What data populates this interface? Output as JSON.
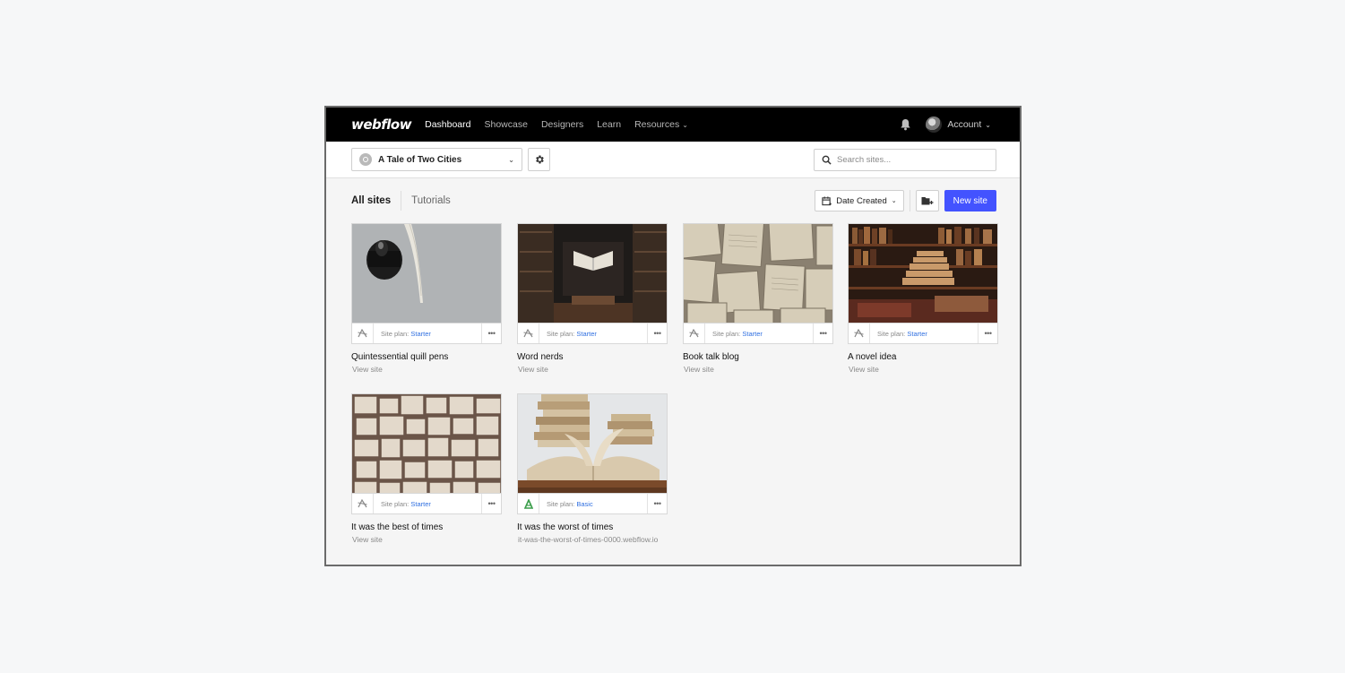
{
  "nav": {
    "logo": "webflow",
    "links": [
      "Dashboard",
      "Showcase",
      "Designers",
      "Learn",
      "Resources"
    ],
    "account": "Account"
  },
  "subbar": {
    "site_name": "A Tale of Two Cities",
    "search_placeholder": "Search sites..."
  },
  "toolbar": {
    "tabs": [
      "All sites",
      "Tutorials"
    ],
    "sort_label": "Date Created",
    "new_site_label": "New site"
  },
  "plan_prefix": "Site plan:",
  "sites": [
    {
      "title": "Quintessential quill pens",
      "plan": "Starter",
      "link": "View site"
    },
    {
      "title": "Word nerds",
      "plan": "Starter",
      "link": "View site"
    },
    {
      "title": "Book talk blog",
      "plan": "Starter",
      "link": "View site"
    },
    {
      "title": "A novel idea",
      "plan": "Starter",
      "link": "View site"
    },
    {
      "title": "It was the best of times",
      "plan": "Starter",
      "link": "View site"
    },
    {
      "title": "It was the worst of times",
      "plan": "Basic",
      "link": "it-was-the-worst-of-times-0000.webflow.io"
    }
  ],
  "colors": {
    "accent": "#4353ff",
    "plan_link": "#2f6fe0",
    "nav_bg": "#000000",
    "basic_icon": "#3a9d4a"
  }
}
